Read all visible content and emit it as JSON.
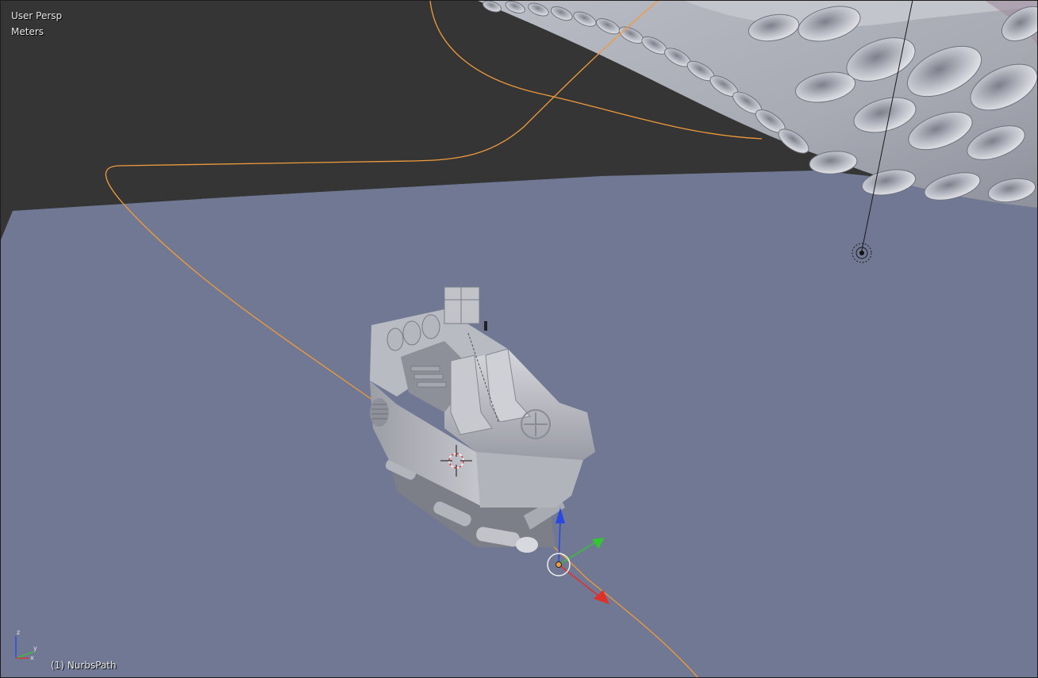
{
  "viewport": {
    "view_name": "User Persp",
    "units": "Meters",
    "active_object_label": "(1) NurbsPath"
  },
  "axes_gizmo": {
    "x_label": "x",
    "y_label": "y",
    "z_label": "z"
  },
  "colors": {
    "background_dark": "#353535",
    "ground_plane": "#707894",
    "path_curve": "#f09a3a",
    "gizmo_x": "#e0302a",
    "gizmo_y": "#34c434",
    "gizmo_z": "#2a48e0",
    "mesh_light": "#c8c8cc",
    "mesh_shadow": "#8a8c94"
  },
  "scene_objects": [
    "nurbs-path",
    "tentacle-mesh",
    "boat-mesh",
    "lamp",
    "3d-cursor",
    "transform-manipulator"
  ]
}
